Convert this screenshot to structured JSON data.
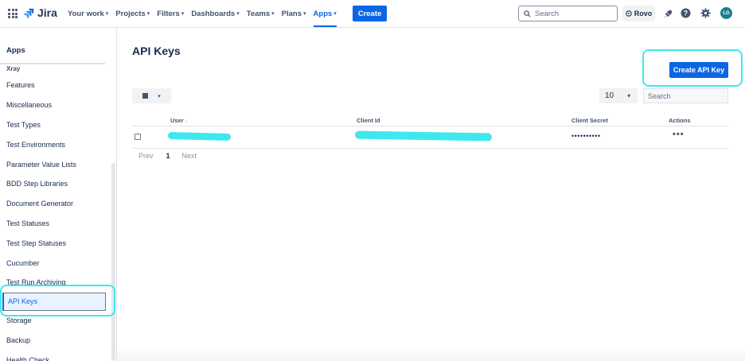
{
  "topnav": {
    "brand": "Jira",
    "items": [
      {
        "label": "Your work"
      },
      {
        "label": "Projects"
      },
      {
        "label": "Filters"
      },
      {
        "label": "Dashboards"
      },
      {
        "label": "Teams"
      },
      {
        "label": "Plans"
      },
      {
        "label": "Apps",
        "active": true
      }
    ],
    "create_label": "Create",
    "search_placeholder": "Search",
    "rovo_label": "Rovo",
    "avatar_initials": "LG"
  },
  "sidebar": {
    "title": "Apps",
    "section": "Xray",
    "items": [
      {
        "label": "Features"
      },
      {
        "label": "Miscellaneous"
      },
      {
        "label": "Test Types"
      },
      {
        "label": "Test Environments"
      },
      {
        "label": "Parameter Value Lists"
      },
      {
        "label": "BDD Step Libraries"
      },
      {
        "label": "Document Generator"
      },
      {
        "label": "Test Statuses"
      },
      {
        "label": "Test Step Statuses"
      },
      {
        "label": "Cucumber"
      },
      {
        "label": "Test Run Archiving"
      },
      {
        "label": "API Keys",
        "selected": true
      },
      {
        "label": "Storage"
      },
      {
        "label": "Backup"
      },
      {
        "label": "Health Check"
      }
    ]
  },
  "main": {
    "title": "API Keys",
    "create_button": "Create API Key",
    "page_size": "10",
    "search_placeholder": "Search",
    "columns": {
      "user": "User",
      "client_id": "Client Id",
      "client_secret": "Client Secret",
      "actions": "Actions"
    },
    "rows": [
      {
        "client_secret": "••••••••••",
        "actions": "•••"
      }
    ],
    "pager": {
      "prev": "Prev",
      "page": "1",
      "next": "Next"
    }
  },
  "colors": {
    "accent": "#0c66e4",
    "highlight": "#3de8ee"
  }
}
